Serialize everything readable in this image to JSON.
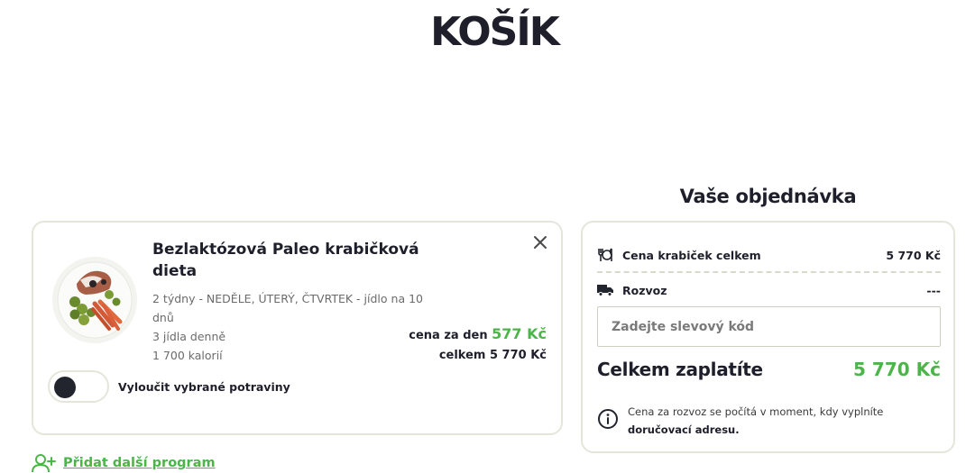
{
  "page": {
    "title": "KOŠÍK"
  },
  "cart_item": {
    "title": "Bezlaktózová Paleo krabičková dieta",
    "details": [
      "2 týdny - NEDĚLE, ÚTERÝ, ČTVRTEK - jídlo na 10 dnů",
      "3 jídla denně",
      "1 700 kalorií"
    ],
    "price_per_day_label": "cena za den",
    "price_per_day_value": "577 Kč",
    "total_label": "celkem",
    "total_value": "5 770 Kč",
    "exclude_foods_label": "Vyloučit vybrané potraviny",
    "exclude_foods_enabled": false
  },
  "add_program": {
    "label": "Přidat další program"
  },
  "summary": {
    "heading": "Vaše objednávka",
    "boxes_label": "Cena krabiček celkem",
    "boxes_value": "5 770 Kč",
    "delivery_label": "Rozvoz",
    "delivery_value": "---",
    "discount_placeholder": "Zadejte slevový kód",
    "total_label": "Celkem zaplatíte",
    "total_value": "5 770 Kč",
    "note_text": "Cena za rozvoz se počítá v moment, kdy vyplníte",
    "note_bold": "doručovací adresu."
  },
  "colors": {
    "accent_green": "#4bb54a",
    "dark_text": "#1f1f2b",
    "card_border": "#e5e6da"
  },
  "icons": [
    "close-icon",
    "cutlery-icon",
    "truck-icon",
    "info-icon",
    "add-user-icon"
  ]
}
